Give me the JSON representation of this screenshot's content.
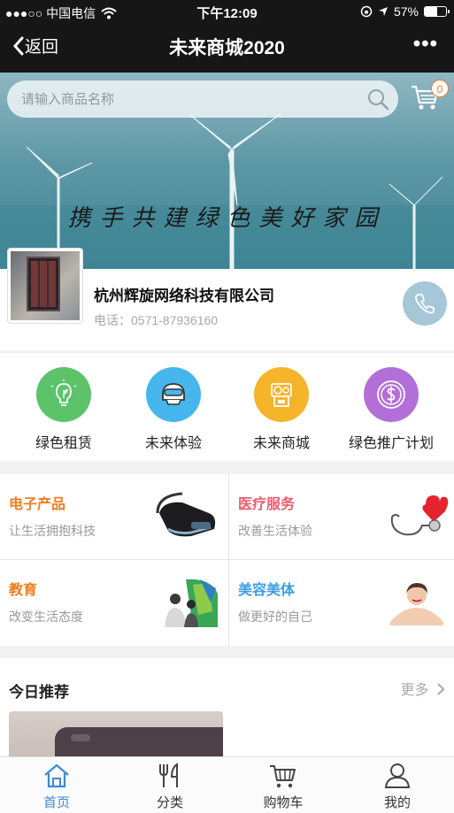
{
  "status": {
    "carrier": "●●●○○ 中国电信",
    "time": "下午12:09",
    "battery": "57%",
    "battery_level": 0.57
  },
  "nav": {
    "back_label": "返回",
    "title": "未来商城2020",
    "more": "•••"
  },
  "search": {
    "placeholder": "请输入商品名称",
    "value": ""
  },
  "cart": {
    "count": "0"
  },
  "banner": {
    "slogan": "携手共建绿色美好家园"
  },
  "company": {
    "name": "杭州辉旋网络科技有限公司",
    "phone": "电话：0571-87936160"
  },
  "quick": [
    {
      "label": "绿色租赁",
      "color": "#5cc36a",
      "icon": "lightbulb-leaf-icon"
    },
    {
      "label": "未来体验",
      "color": "#47b6ec",
      "icon": "helmet-icon"
    },
    {
      "label": "未来商城",
      "color": "#f6b42a",
      "icon": "shop-icon"
    },
    {
      "label": "绿色推广计划",
      "color": "#b36fd8",
      "icon": "dollar-coin-icon"
    }
  ],
  "categories": [
    {
      "title": "电子产品",
      "subtitle": "让生活拥抱科技",
      "color": "#f07d1e"
    },
    {
      "title": "医疗服务",
      "subtitle": "改善生活体验",
      "color": "#ef5b6a"
    },
    {
      "title": "教育",
      "subtitle": "改变生活态度",
      "color": "#f07d1e"
    },
    {
      "title": "美容美体",
      "subtitle": "做更好的自己",
      "color": "#3b9ee6"
    }
  ],
  "recommend": {
    "title": "今日推荐",
    "more": "更多"
  },
  "tabs": [
    {
      "label": "首页",
      "icon": "home-icon",
      "active": true
    },
    {
      "label": "分类",
      "icon": "fork-knife-icon",
      "active": false
    },
    {
      "label": "购物车",
      "icon": "cart-icon",
      "active": false
    },
    {
      "label": "我的",
      "icon": "person-icon",
      "active": false
    }
  ],
  "colors": {
    "accent": "#3d8ad6",
    "navbar": "#161616"
  }
}
